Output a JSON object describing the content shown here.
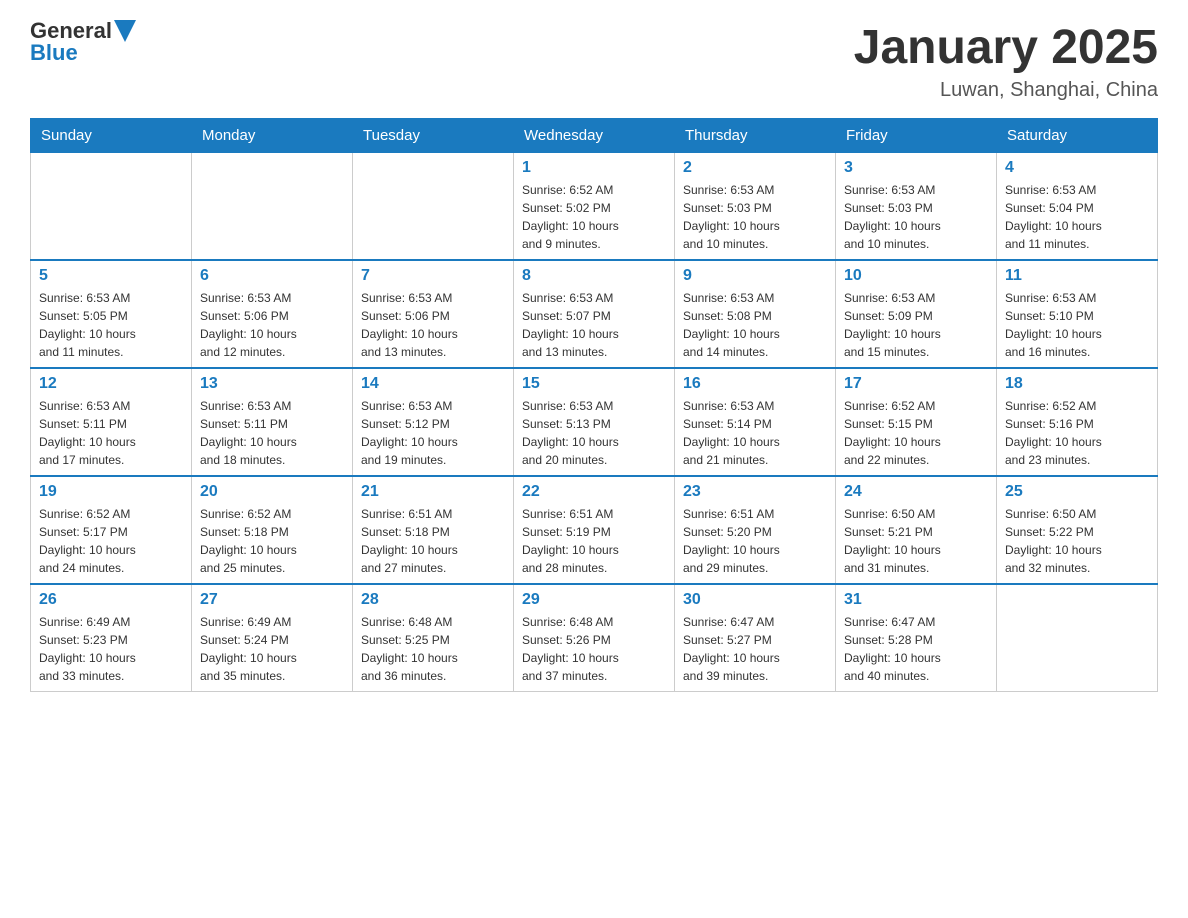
{
  "header": {
    "logo_general": "General",
    "logo_blue": "Blue",
    "title": "January 2025",
    "subtitle": "Luwan, Shanghai, China"
  },
  "weekdays": [
    "Sunday",
    "Monday",
    "Tuesday",
    "Wednesday",
    "Thursday",
    "Friday",
    "Saturday"
  ],
  "weeks": [
    [
      {
        "day": "",
        "info": ""
      },
      {
        "day": "",
        "info": ""
      },
      {
        "day": "",
        "info": ""
      },
      {
        "day": "1",
        "info": "Sunrise: 6:52 AM\nSunset: 5:02 PM\nDaylight: 10 hours\nand 9 minutes."
      },
      {
        "day": "2",
        "info": "Sunrise: 6:53 AM\nSunset: 5:03 PM\nDaylight: 10 hours\nand 10 minutes."
      },
      {
        "day": "3",
        "info": "Sunrise: 6:53 AM\nSunset: 5:03 PM\nDaylight: 10 hours\nand 10 minutes."
      },
      {
        "day": "4",
        "info": "Sunrise: 6:53 AM\nSunset: 5:04 PM\nDaylight: 10 hours\nand 11 minutes."
      }
    ],
    [
      {
        "day": "5",
        "info": "Sunrise: 6:53 AM\nSunset: 5:05 PM\nDaylight: 10 hours\nand 11 minutes."
      },
      {
        "day": "6",
        "info": "Sunrise: 6:53 AM\nSunset: 5:06 PM\nDaylight: 10 hours\nand 12 minutes."
      },
      {
        "day": "7",
        "info": "Sunrise: 6:53 AM\nSunset: 5:06 PM\nDaylight: 10 hours\nand 13 minutes."
      },
      {
        "day": "8",
        "info": "Sunrise: 6:53 AM\nSunset: 5:07 PM\nDaylight: 10 hours\nand 13 minutes."
      },
      {
        "day": "9",
        "info": "Sunrise: 6:53 AM\nSunset: 5:08 PM\nDaylight: 10 hours\nand 14 minutes."
      },
      {
        "day": "10",
        "info": "Sunrise: 6:53 AM\nSunset: 5:09 PM\nDaylight: 10 hours\nand 15 minutes."
      },
      {
        "day": "11",
        "info": "Sunrise: 6:53 AM\nSunset: 5:10 PM\nDaylight: 10 hours\nand 16 minutes."
      }
    ],
    [
      {
        "day": "12",
        "info": "Sunrise: 6:53 AM\nSunset: 5:11 PM\nDaylight: 10 hours\nand 17 minutes."
      },
      {
        "day": "13",
        "info": "Sunrise: 6:53 AM\nSunset: 5:11 PM\nDaylight: 10 hours\nand 18 minutes."
      },
      {
        "day": "14",
        "info": "Sunrise: 6:53 AM\nSunset: 5:12 PM\nDaylight: 10 hours\nand 19 minutes."
      },
      {
        "day": "15",
        "info": "Sunrise: 6:53 AM\nSunset: 5:13 PM\nDaylight: 10 hours\nand 20 minutes."
      },
      {
        "day": "16",
        "info": "Sunrise: 6:53 AM\nSunset: 5:14 PM\nDaylight: 10 hours\nand 21 minutes."
      },
      {
        "day": "17",
        "info": "Sunrise: 6:52 AM\nSunset: 5:15 PM\nDaylight: 10 hours\nand 22 minutes."
      },
      {
        "day": "18",
        "info": "Sunrise: 6:52 AM\nSunset: 5:16 PM\nDaylight: 10 hours\nand 23 minutes."
      }
    ],
    [
      {
        "day": "19",
        "info": "Sunrise: 6:52 AM\nSunset: 5:17 PM\nDaylight: 10 hours\nand 24 minutes."
      },
      {
        "day": "20",
        "info": "Sunrise: 6:52 AM\nSunset: 5:18 PM\nDaylight: 10 hours\nand 25 minutes."
      },
      {
        "day": "21",
        "info": "Sunrise: 6:51 AM\nSunset: 5:18 PM\nDaylight: 10 hours\nand 27 minutes."
      },
      {
        "day": "22",
        "info": "Sunrise: 6:51 AM\nSunset: 5:19 PM\nDaylight: 10 hours\nand 28 minutes."
      },
      {
        "day": "23",
        "info": "Sunrise: 6:51 AM\nSunset: 5:20 PM\nDaylight: 10 hours\nand 29 minutes."
      },
      {
        "day": "24",
        "info": "Sunrise: 6:50 AM\nSunset: 5:21 PM\nDaylight: 10 hours\nand 31 minutes."
      },
      {
        "day": "25",
        "info": "Sunrise: 6:50 AM\nSunset: 5:22 PM\nDaylight: 10 hours\nand 32 minutes."
      }
    ],
    [
      {
        "day": "26",
        "info": "Sunrise: 6:49 AM\nSunset: 5:23 PM\nDaylight: 10 hours\nand 33 minutes."
      },
      {
        "day": "27",
        "info": "Sunrise: 6:49 AM\nSunset: 5:24 PM\nDaylight: 10 hours\nand 35 minutes."
      },
      {
        "day": "28",
        "info": "Sunrise: 6:48 AM\nSunset: 5:25 PM\nDaylight: 10 hours\nand 36 minutes."
      },
      {
        "day": "29",
        "info": "Sunrise: 6:48 AM\nSunset: 5:26 PM\nDaylight: 10 hours\nand 37 minutes."
      },
      {
        "day": "30",
        "info": "Sunrise: 6:47 AM\nSunset: 5:27 PM\nDaylight: 10 hours\nand 39 minutes."
      },
      {
        "day": "31",
        "info": "Sunrise: 6:47 AM\nSunset: 5:28 PM\nDaylight: 10 hours\nand 40 minutes."
      },
      {
        "day": "",
        "info": ""
      }
    ]
  ]
}
